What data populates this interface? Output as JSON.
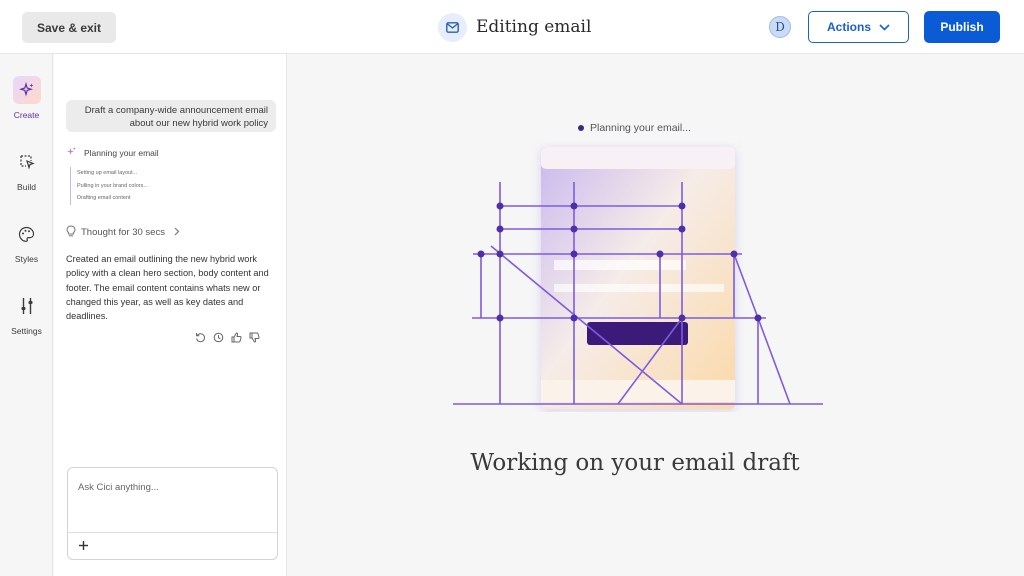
{
  "header": {
    "save_label": "Save & exit",
    "title": "Editing email",
    "title_icon": "mail-icon",
    "avatar_initial": "D",
    "actions_label": "Actions",
    "publish_label": "Publish"
  },
  "rail": {
    "items": [
      {
        "label": "Create",
        "icon": "sparkle-icon",
        "active": true
      },
      {
        "label": "Build",
        "icon": "cursor-select-icon",
        "active": false
      },
      {
        "label": "Styles",
        "icon": "palette-icon",
        "active": false
      },
      {
        "label": "Settings",
        "icon": "sliders-icon",
        "active": false
      }
    ]
  },
  "chat": {
    "prompt": "Draft a company-wide announcement email about our new hybrid work policy",
    "planning_label": "Planning your email",
    "steps": [
      "Setting up email layout...",
      "Pulling in your brand colors...",
      "Drafting email content"
    ],
    "thought_label": "Thought for 30 secs",
    "response": "Created an email outlining the new hybrid work policy with a clean hero section, body content and footer. The email content contains whats new or changed this year, as well as key dates and deadlines.",
    "ask_placeholder": "Ask Cici anything..."
  },
  "canvas": {
    "status": "Planning your email...",
    "working_text": "Working on your email draft"
  },
  "colors": {
    "primary": "#0b5ad6",
    "accent_purple": "#6a44c8",
    "scaffold": "#7d5ce0",
    "button_dark": "#3b1a7a"
  }
}
